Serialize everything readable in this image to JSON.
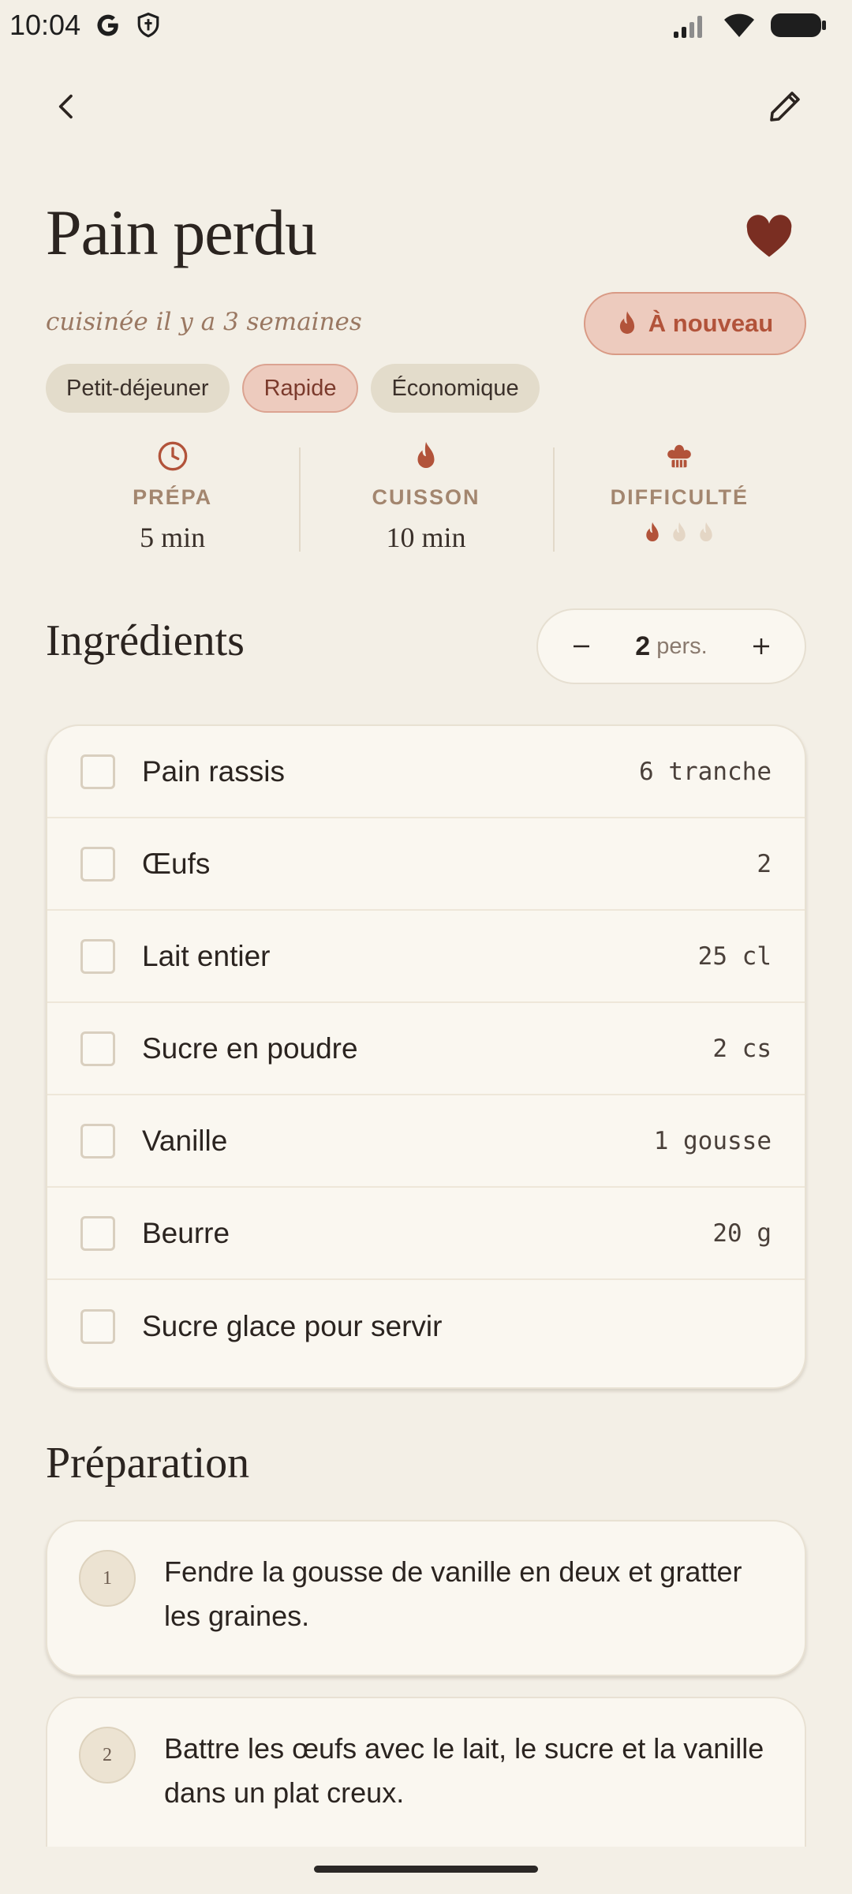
{
  "status_bar": {
    "time": "10:04"
  },
  "recipe": {
    "title": "Pain perdu",
    "cooked_ago": "cuisinée il y a 3 semaines",
    "again_label": "À nouveau",
    "favorite": true,
    "tags": [
      "Petit-déjeuner",
      "Rapide",
      "Économique"
    ],
    "stats": {
      "prep_label": "PRÉPA",
      "prep_value": "5 min",
      "cook_label": "CUISSON",
      "cook_value": "10 min",
      "difficulty_label": "DIFFICULTÉ",
      "difficulty_level": 1,
      "difficulty_max": 3
    }
  },
  "ingredients": {
    "title": "Ingrédients",
    "servings_value": "2",
    "servings_unit": "pers.",
    "items": [
      {
        "name": "Pain rassis",
        "qty": "6 tranche"
      },
      {
        "name": "Œufs",
        "qty": "2"
      },
      {
        "name": "Lait entier",
        "qty": "25 cl"
      },
      {
        "name": "Sucre en poudre",
        "qty": "2 cs"
      },
      {
        "name": "Vanille",
        "qty": "1 gousse"
      },
      {
        "name": "Beurre",
        "qty": "20 g"
      },
      {
        "name": "Sucre glace pour servir",
        "qty": ""
      }
    ]
  },
  "preparation": {
    "title": "Préparation",
    "steps": [
      {
        "num": "1",
        "text": "Fendre la gousse de vanille en deux et gratter les graines."
      },
      {
        "num": "2",
        "text": "Battre les œufs avec le lait, le sucre et la vanille dans un plat creux."
      }
    ]
  },
  "colors": {
    "accent": "#b2533a",
    "heart": "#7a2e22",
    "background": "#f3efe6",
    "card": "#faf7f0"
  }
}
